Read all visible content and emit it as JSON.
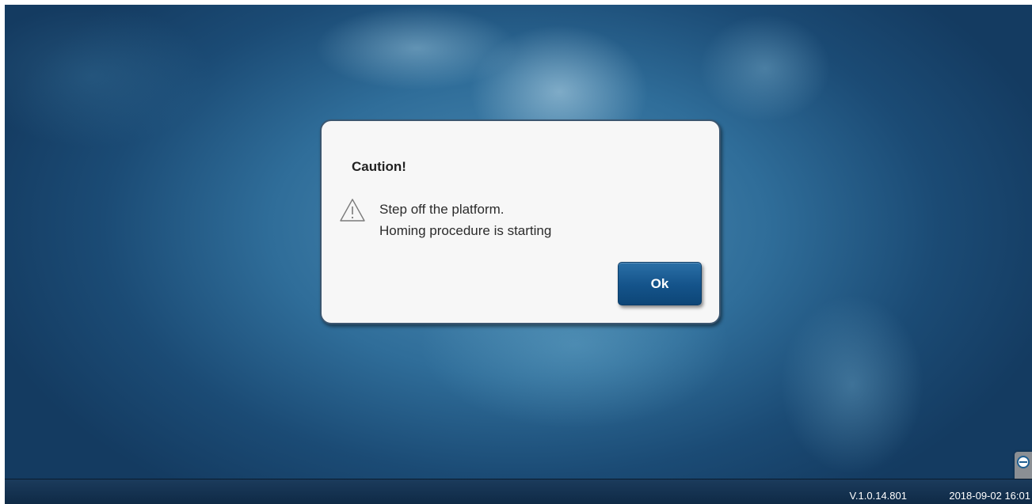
{
  "dialog": {
    "title": "Caution!",
    "icon": "warning-triangle",
    "message_lines": [
      "Step off the platform.",
      "Homing procedure is starting"
    ],
    "ok_label": "Ok"
  },
  "status_bar": {
    "version": "V.1.0.14.801",
    "datetime": "2018-09-02 16:01"
  },
  "side_tab": {
    "icon": "teamviewer-icon"
  },
  "colors": {
    "background": "#2f6d99",
    "button": "#14538a",
    "status_bar": "#0f2a46",
    "dialog_border": "#3b5670"
  }
}
